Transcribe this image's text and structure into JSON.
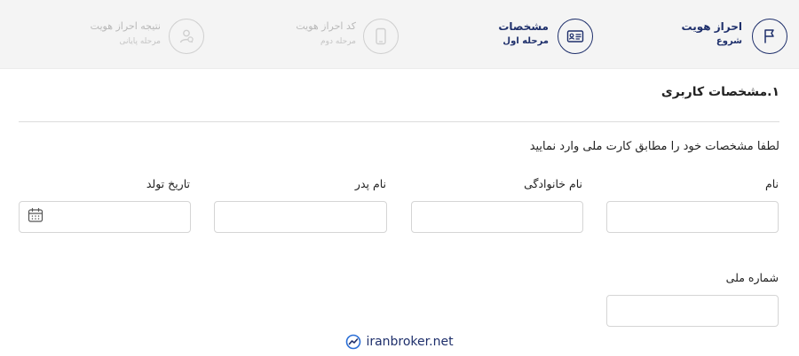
{
  "stepper": {
    "steps": [
      {
        "title": "احراز هویت",
        "subtitle": "شروع",
        "icon": "flag-icon",
        "state": "done"
      },
      {
        "title": "مشخصات",
        "subtitle": "مرحله اول",
        "icon": "id-card-icon",
        "state": "active"
      },
      {
        "title": "کد احراز هویت",
        "subtitle": "مرحله دوم",
        "icon": "mobile-phone-icon",
        "state": "inactive"
      },
      {
        "title": "نتیجه احراز هویت",
        "subtitle": "مرحله پایانی",
        "icon": "user-check-icon",
        "state": "inactive"
      }
    ]
  },
  "form": {
    "section_title": "۱.مشخصات کاربری",
    "instruction": "لطفا مشخصات خود را مطابق کارت ملی وارد نمایید",
    "fields": {
      "first_name": {
        "label": "نام",
        "value": ""
      },
      "last_name": {
        "label": "نام خانوادگی",
        "value": ""
      },
      "father_name": {
        "label": "نام پدر",
        "value": ""
      },
      "birth_date": {
        "label": "تاریخ تولد",
        "value": "",
        "icon": "calendar-icon"
      },
      "national_id": {
        "label": "شماره ملی",
        "value": ""
      }
    }
  },
  "footer": {
    "brand": "iranbroker.net",
    "icon": "chart-logo-icon"
  },
  "colors": {
    "primary": "#1e2f6b",
    "stepper_bg": "#f4f4f4",
    "inactive": "#c4c4c4"
  }
}
